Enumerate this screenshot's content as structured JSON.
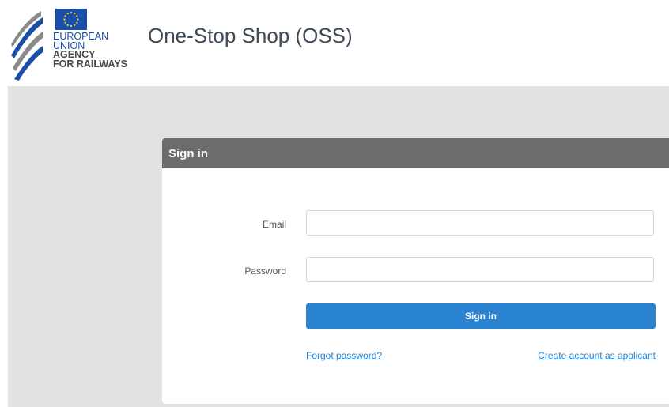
{
  "header": {
    "logo": {
      "line1": "EUROPEAN",
      "line2": "UNION",
      "line3": "AGENCY",
      "line4": "FOR RAILWAYS",
      "icon": "eu-flag-icon",
      "colors": {
        "eu_blue": "#1a4ea8",
        "stripe_gray": "#8a8a8a",
        "star_yellow": "#ffdd00"
      }
    },
    "title": "One-Stop Shop (OSS)"
  },
  "signin_panel": {
    "title": "Sign in",
    "email": {
      "label": "Email",
      "value": "",
      "placeholder": ""
    },
    "password": {
      "label": "Password",
      "value": "",
      "placeholder": ""
    },
    "submit_label": "Sign in",
    "forgot_link": "Forgot password?",
    "create_account_link": "Create account as applicant"
  },
  "colors": {
    "accent": "#2a84d1",
    "panel_header": "#6c6c6c",
    "background": "#e2e2e2"
  }
}
